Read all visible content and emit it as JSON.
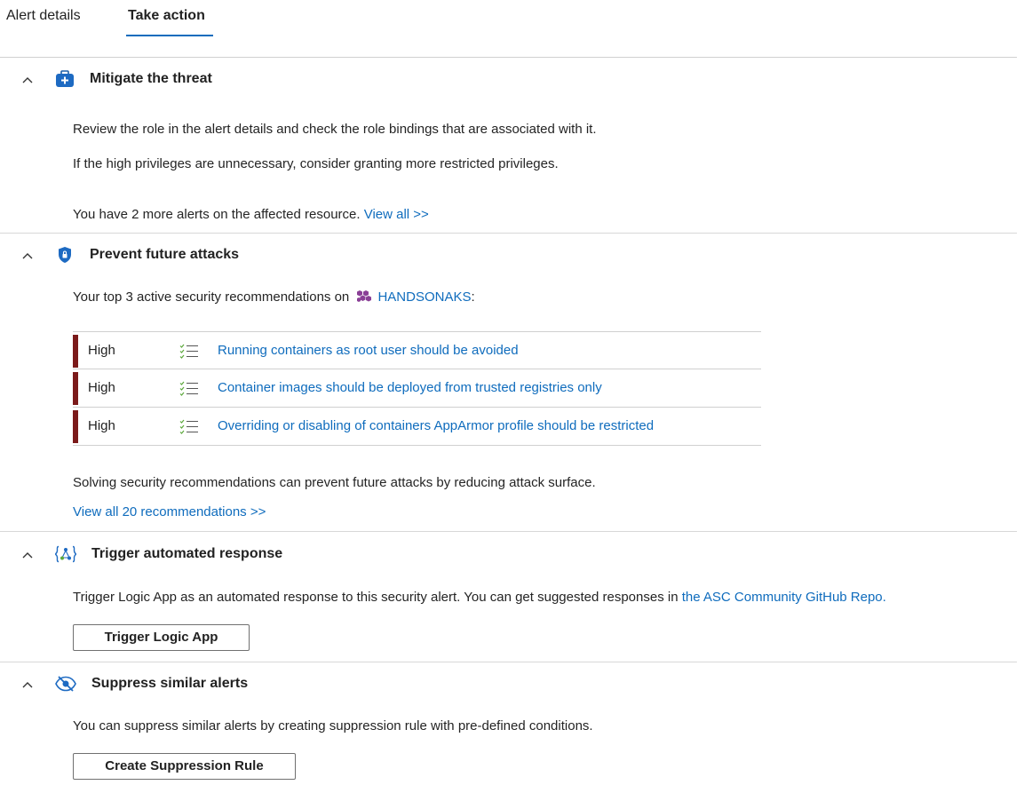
{
  "tabs": [
    {
      "label": "Alert details"
    },
    {
      "label": "Take action"
    }
  ],
  "mitigate": {
    "title": "Mitigate the threat",
    "line1": "Review the role in the alert details and check the role bindings that are associated with it.",
    "line2": "If the high privileges are unnecessary, consider granting more restricted privileges.",
    "alerts_text": "You have 2 more alerts on the affected resource.",
    "view_all_link": "View all >>"
  },
  "prevent": {
    "title": "Prevent future attacks",
    "intro_text": "Your top 3 active security recommendations on",
    "resource_name": "HANDSONAKS",
    "intro_suffix": ":",
    "recommendations": [
      {
        "severity": "High",
        "title": "Running containers as root user should be avoided"
      },
      {
        "severity": "High",
        "title": "Container images should be deployed from trusted registries only"
      },
      {
        "severity": "High",
        "title": "Overriding or disabling of containers AppArmor profile should be restricted"
      }
    ],
    "footer_text": "Solving security recommendations can prevent future attacks by reducing attack surface.",
    "view_all_link": "View all 20 recommendations >>"
  },
  "trigger": {
    "title": "Trigger automated response",
    "text": "Trigger Logic App as an automated response to this security alert. You can get suggested responses in",
    "link": "the ASC Community GitHub Repo.",
    "button_label": "Trigger Logic App"
  },
  "suppress": {
    "title": "Suppress similar alerts",
    "text": "You can suppress similar alerts by creating suppression rule with pre-defined conditions.",
    "button_label": "Create Suppression Rule"
  },
  "colors": {
    "accent": "#0f6cbd",
    "severity_high": "#7b1a1a"
  },
  "icons": {
    "mitigate": "medical-kit-icon",
    "prevent": "shield-lock-icon",
    "resource": "kubernetes-cluster-icon",
    "recommendation": "checklist-icon",
    "trigger": "logic-app-icon",
    "suppress": "eye-hidden-icon",
    "collapse": "chevron-up-icon"
  }
}
